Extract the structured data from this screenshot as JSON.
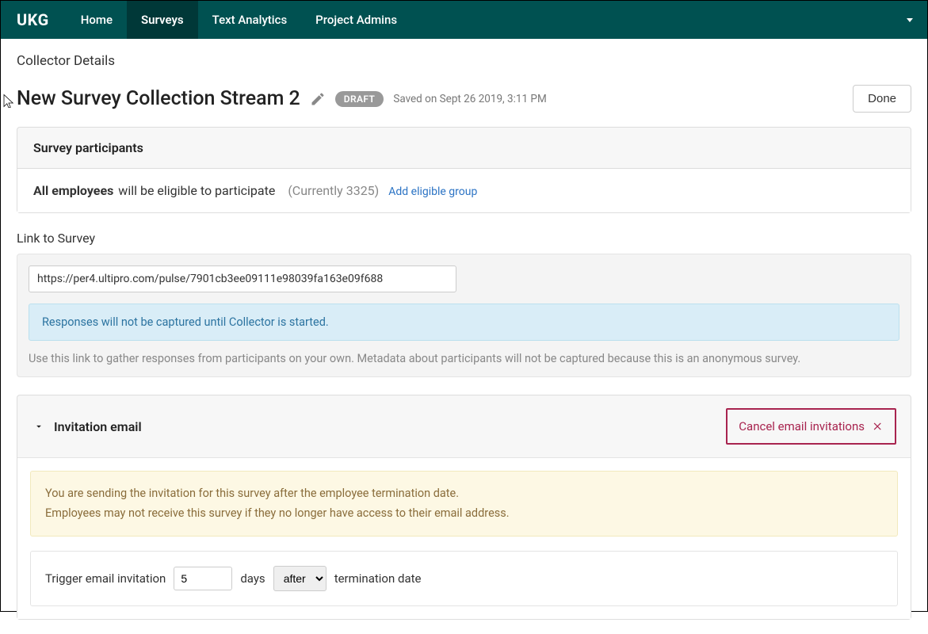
{
  "nav": {
    "logo": "UKG",
    "items": [
      "Home",
      "Surveys",
      "Text Analytics",
      "Project Admins"
    ],
    "active_index": 1
  },
  "breadcrumb": "Collector Details",
  "title": "New Survey Collection Stream 2",
  "status_badge": "DRAFT",
  "saved_text": "Saved on Sept 26 2019, 3:11 PM",
  "done_button": "Done",
  "participants": {
    "header": "Survey participants",
    "bold": "All employees",
    "rest": "will be eligible to participate",
    "count": "(Currently 3325)",
    "link": "Add eligible group"
  },
  "link_section": {
    "label": "Link to Survey",
    "url": "https://per4.ultipro.com/pulse/7901cb3ee09111e98039fa163e09f688",
    "info": "Responses will not be captured until Collector is started.",
    "help": "Use this link to gather responses from participants on your own. Metadata about participants will not be captured because this is an anonymous survey."
  },
  "invitation": {
    "header": "Invitation email",
    "cancel": "Cancel email invitations",
    "warn_line1": "You are sending the invitation for this survey after the employee termination date.",
    "warn_line2": "Employees may not receive this survey if they no longer have access to their email address.",
    "trigger_prefix": "Trigger email invitation",
    "trigger_days_value": "5",
    "trigger_days_label": "days",
    "trigger_select_value": "after",
    "trigger_suffix": "termination date"
  }
}
